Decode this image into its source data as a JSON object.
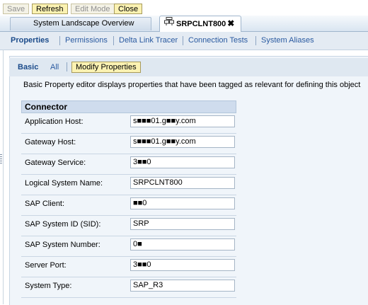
{
  "toolbar": {
    "save": "Save",
    "refresh": "Refresh",
    "edit_mode": "Edit Mode",
    "close": "Close"
  },
  "tabs": {
    "overview": "System Landscape Overview",
    "active": "SRPCLNT800",
    "active_icon": "system-icon",
    "close_icon": "✖"
  },
  "subnav": {
    "items": [
      "Properties",
      "Permissions",
      "Delta Link Tracer",
      "Connection Tests",
      "System Aliases"
    ],
    "active": "Properties"
  },
  "modes": {
    "basic": "Basic",
    "all": "All",
    "modify": "Modify Properties"
  },
  "description": "Basic Property editor displays properties that have been tagged as relevant for defining this object",
  "connector": {
    "title": "Connector",
    "fields": [
      {
        "label": "Application Host:",
        "value": "s■■■01.g■■y.com"
      },
      {
        "label": "Gateway Host:",
        "value": "s■■■01.g■■y.com"
      },
      {
        "label": "Gateway Service:",
        "value": "3■■0"
      },
      {
        "label": "Logical System Name:",
        "value": "SRPCLNT800"
      },
      {
        "label": "SAP Client:",
        "value": "■■0"
      },
      {
        "label": "SAP System ID (SID):",
        "value": "SRP"
      },
      {
        "label": "SAP System Number:",
        "value": "0■"
      },
      {
        "label": "Server Port:",
        "value": "3■■0"
      },
      {
        "label": "System Type:",
        "value": "SAP_R3"
      }
    ]
  },
  "colors": {
    "button_bg": "#fbf2b2",
    "link": "#2a5aa0",
    "header_bg": "#cfdced"
  }
}
